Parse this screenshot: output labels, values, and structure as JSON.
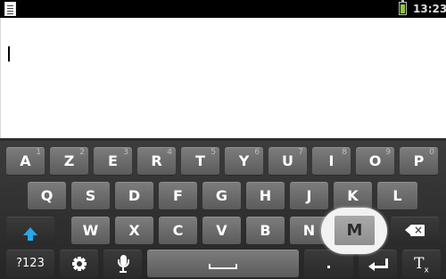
{
  "status_bar": {
    "time": "13:23",
    "icons": [
      "document-notification-icon",
      "battery-charging-icon"
    ],
    "battery_color": "#8bc93c"
  },
  "text_area": {
    "value": ""
  },
  "keyboard": {
    "row1": [
      {
        "label": "A",
        "hint": "1"
      },
      {
        "label": "Z",
        "hint": "2"
      },
      {
        "label": "E",
        "hint": "3"
      },
      {
        "label": "R",
        "hint": "4"
      },
      {
        "label": "T",
        "hint": "5"
      },
      {
        "label": "Y",
        "hint": "6"
      },
      {
        "label": "U",
        "hint": "7"
      },
      {
        "label": "I",
        "hint": "8"
      },
      {
        "label": "O",
        "hint": "9"
      },
      {
        "label": "P",
        "hint": "0"
      }
    ],
    "row2": [
      "Q",
      "S",
      "D",
      "F",
      "G",
      "H",
      "J",
      "K",
      "L"
    ],
    "row3": [
      "W",
      "X",
      "C",
      "V",
      "B",
      "N",
      "M"
    ],
    "numbers_label": "?123",
    "period_label": ".",
    "function_icons": [
      "shift-icon",
      "backspace-icon",
      "gear-icon",
      "microphone-icon",
      "space-bar-icon",
      "enter-icon",
      "text-format-icon"
    ],
    "shift_color": "#2aa7e8",
    "popup_key": "M"
  }
}
